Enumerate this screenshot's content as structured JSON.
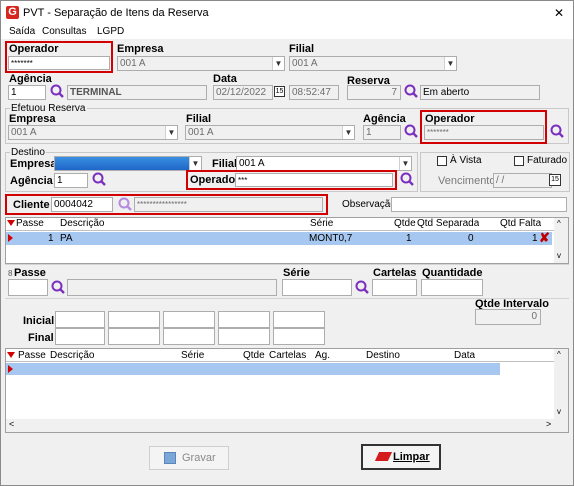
{
  "window": {
    "title": "PVT - Separação de Itens da Reserva",
    "close": "✕"
  },
  "menu": [
    "Saída",
    "Consultas",
    "LGPD"
  ],
  "header": {
    "operador_label": "Operador",
    "operador_value": "*******",
    "empresa_label": "Empresa",
    "empresa_value": "001 A",
    "filial_label": "Filial",
    "filial_value": "001 A",
    "agencia_label": "Agência",
    "agencia_value": "1",
    "agencia_name": "TERMINAL",
    "data_label": "Data",
    "data_value": "02/12/2022",
    "hora_value": "08:52:47",
    "reserva_label": "Reserva",
    "reserva_value": "7",
    "status_value": "Em aberto"
  },
  "efetuou": {
    "legend": "Efetuou Reserva",
    "empresa_label": "Empresa",
    "empresa_value": "001 A",
    "filial_label": "Filial",
    "filial_value": "001 A",
    "agencia_label": "Agência",
    "agencia_value": "1",
    "operador_label": "Operador",
    "operador_value": "*******"
  },
  "destino": {
    "legend": "Destino",
    "empresa_label": "Empresa",
    "empresa_value": "",
    "filial_label": "Filial",
    "filial_value": "001 A",
    "agencia_label": "Agência",
    "agencia_value": "1",
    "operador_label": "Operador",
    "operador_value": "***",
    "avista_label": "À Vista",
    "faturado_label": "Faturado",
    "vencimento_label": "Vencimento",
    "vencimento_value": " / /"
  },
  "cliente": {
    "label": "Cliente",
    "code": "0004042",
    "name": "****************",
    "obs_label": "Observação",
    "obs_value": ""
  },
  "grid1": {
    "columns": [
      "Passe",
      "Descrição",
      "Série",
      "Qtde",
      "Qtd Separada",
      "Qtd Falta"
    ],
    "rows": [
      {
        "passe": "1",
        "descricao": "PA",
        "serie": "MONT0,7",
        "qtde": "1",
        "separada": "0",
        "falta": "1"
      }
    ]
  },
  "entry": {
    "passe_label": "Passe",
    "serie_label": "Série",
    "cartelas_label": "Cartelas",
    "quantidade_label": "Quantidade",
    "qtde_intervalo_label": "Qtde Intervalo",
    "qtde_intervalo_value": "0",
    "inicial_label": "Inicial",
    "final_label": "Final"
  },
  "grid2": {
    "columns": [
      "Passe",
      "Descrição",
      "Série",
      "Qtde",
      "Cartelas",
      "Ag.",
      "Destino",
      "Data"
    ]
  },
  "buttons": {
    "gravar": "Gravar",
    "limpar": "Limpar"
  }
}
